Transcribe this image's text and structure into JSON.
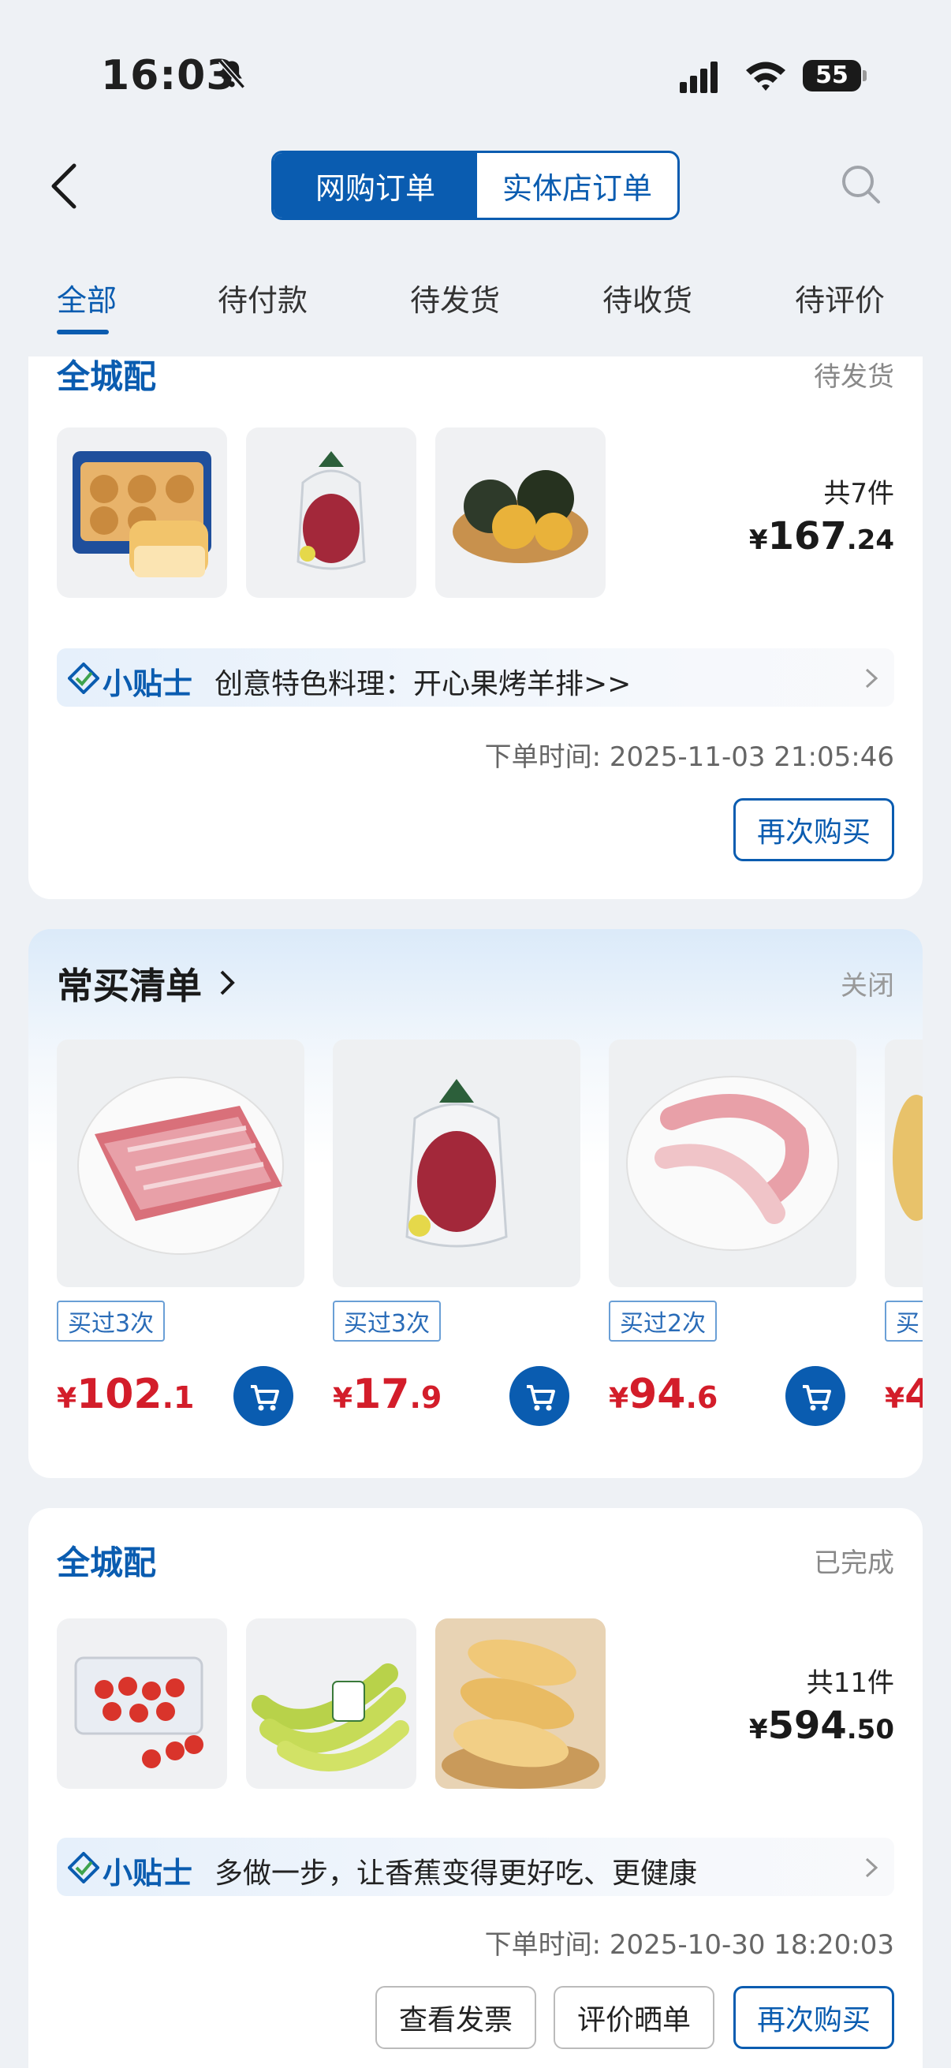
{
  "status_bar": {
    "time": "16:03",
    "battery": "55"
  },
  "header": {
    "seg_online": "网购订单",
    "seg_store": "实体店订单"
  },
  "tabs": [
    "全部",
    "待付款",
    "待发货",
    "待收货",
    "待评价"
  ],
  "orders": [
    {
      "channel": "全城配",
      "status": "待发货",
      "qty": "共7件",
      "currency": "¥",
      "price_int": "167",
      "price_dec": ".24",
      "tip_label": "小贴士",
      "tip_text": "创意特色料理：开心果烤羊排>>",
      "order_time": "下单时间: 2025-11-03 21:05:46",
      "buttons": [
        "再次购买"
      ]
    },
    {
      "channel": "全城配",
      "status": "已完成",
      "qty": "共11件",
      "currency": "¥",
      "price_int": "594",
      "price_dec": ".50",
      "tip_label": "小贴士",
      "tip_text": "多做一步，让香蕉变得更好吃、更健康",
      "order_time": "下单时间: 2025-10-30 18:20:03",
      "buttons": [
        "查看发票",
        "评价晒单",
        "再次购买"
      ]
    }
  ],
  "frequent": {
    "title": "常买清单",
    "close": "关闭",
    "items": [
      {
        "badge": "买过3次",
        "currency": "¥",
        "price_int": "102",
        "price_dec": ".1"
      },
      {
        "badge": "买过3次",
        "currency": "¥",
        "price_int": "17",
        "price_dec": ".9"
      },
      {
        "badge": "买过2次",
        "currency": "¥",
        "price_int": "94",
        "price_dec": ".6"
      },
      {
        "badge": "买",
        "currency": "¥",
        "price_int": "4",
        "price_dec": ""
      }
    ]
  },
  "colors": {
    "brand": "#0a5cb0",
    "price_red": "#d31d2a",
    "page_bg": "#eef1f5"
  }
}
